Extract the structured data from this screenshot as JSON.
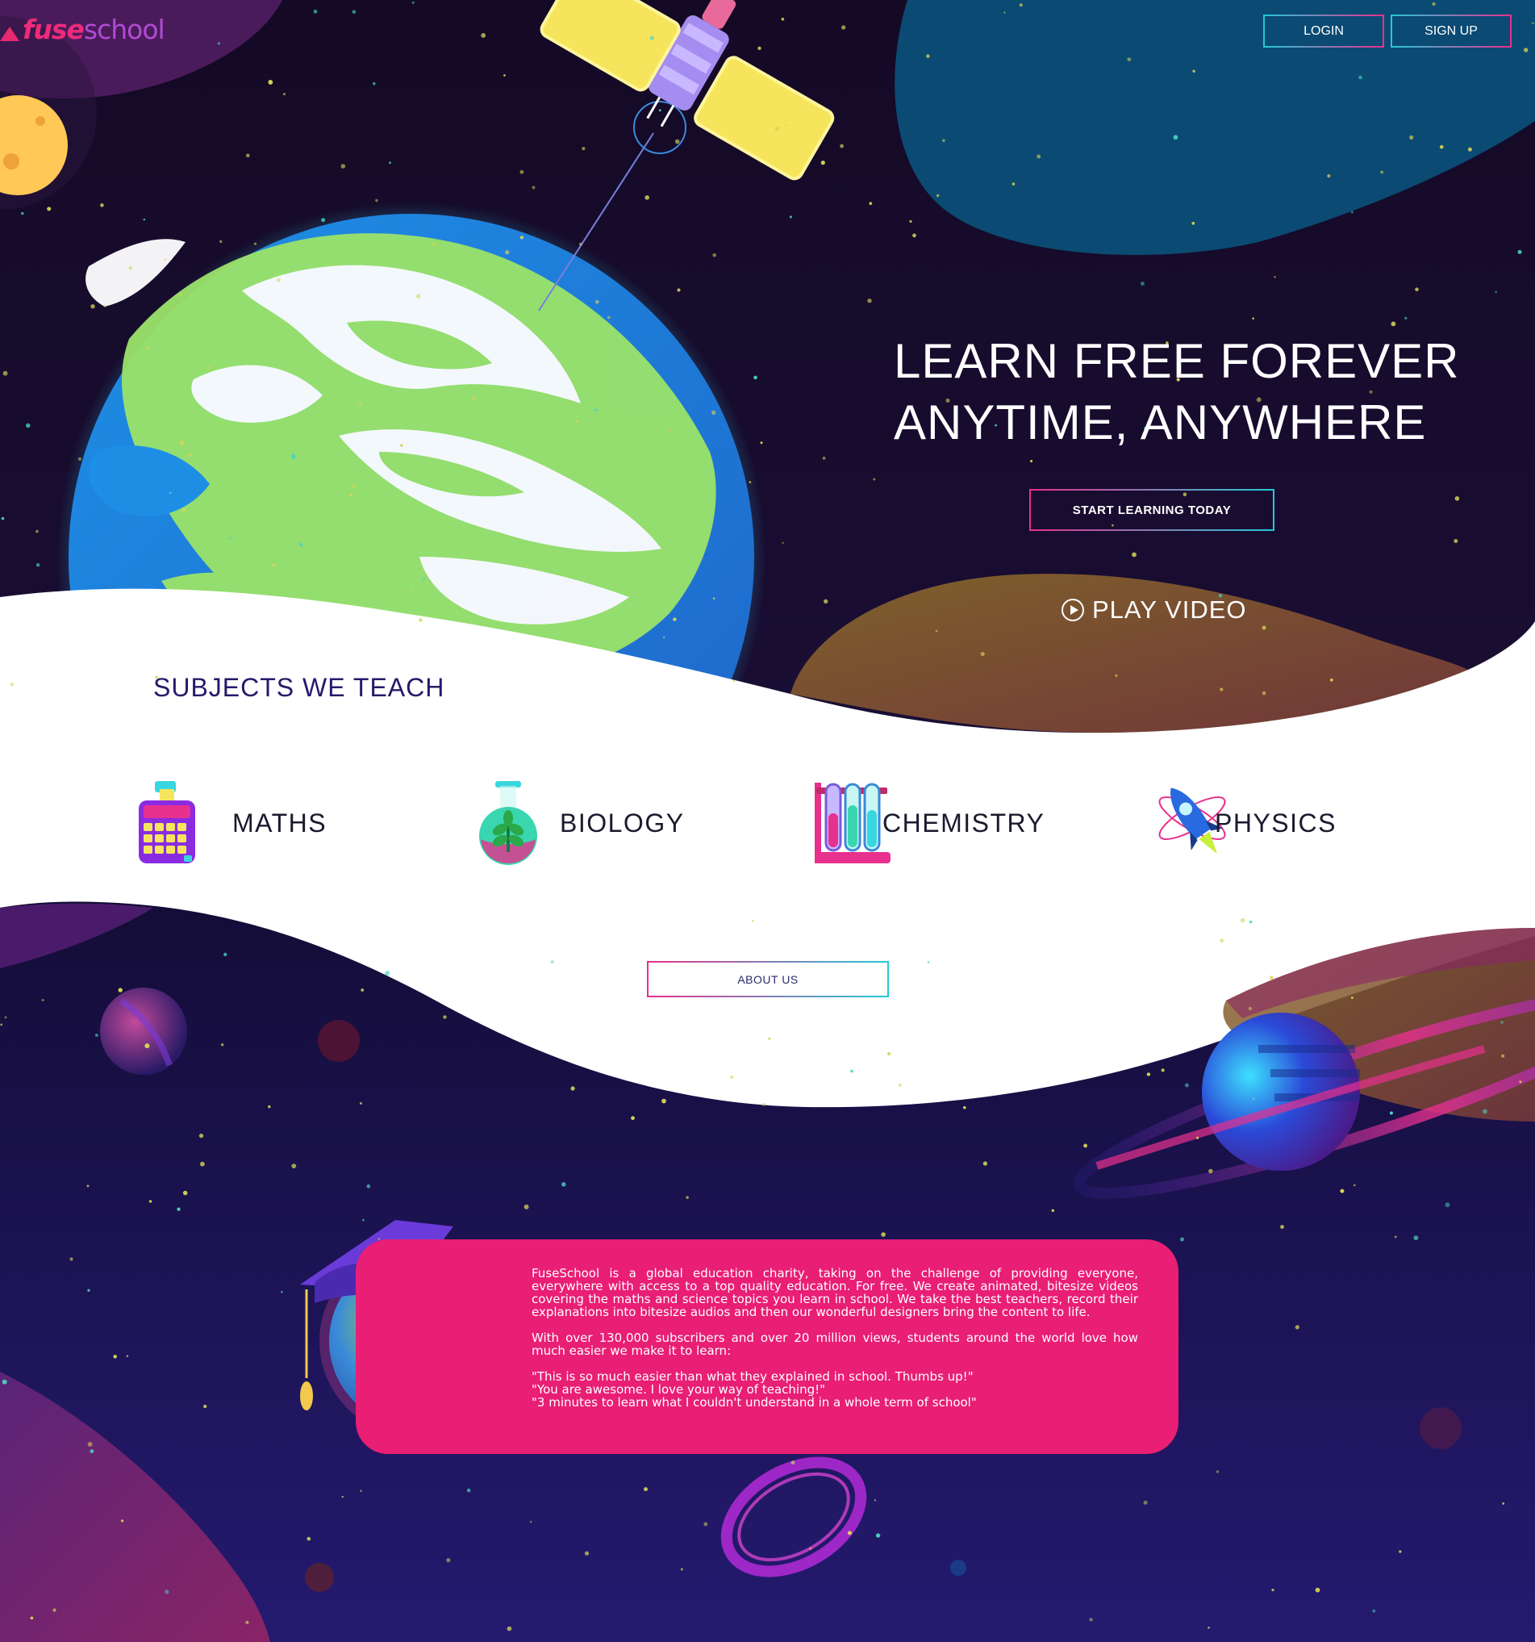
{
  "brand": {
    "name_part1": "fuse",
    "name_part2": "school"
  },
  "header": {
    "login_label": "LOGIN",
    "signup_label": "SIGN UP"
  },
  "hero": {
    "title_line1": "LEARN FREE FOREVER",
    "title_line2": "ANYTIME, ANYWHERE",
    "cta_label": "START LEARNING TODAY",
    "play_label": "PLAY VIDEO"
  },
  "subjects": {
    "heading": "SUBJECTS WE TEACH",
    "items": [
      {
        "label": "MATHS",
        "icon": "calculator-icon"
      },
      {
        "label": "BIOLOGY",
        "icon": "flask-plant-icon"
      },
      {
        "label": "CHEMISTRY",
        "icon": "test-tubes-icon"
      },
      {
        "label": "PHYSICS",
        "icon": "rocket-atom-icon"
      }
    ],
    "about_button_label": "ABOUT US"
  },
  "about": {
    "paragraph1": "FuseSchool is a global education charity, taking on the challenge of providing everyone, everywhere with access to a top quality education. For free. We create animated, bitesize videos covering the maths and science topics you learn in school. We take the best teachers, record their explanations into bitesize audios and then our wonderful designers bring the content to life.",
    "paragraph2": "With over 130,000 subscribers and over 20 million views, students around the world love how much easier we make it to learn:",
    "quotes": [
      "\"This is so much easier than what they explained in school. Thumbs up!\"",
      "\"You are awesome. I love your way of teaching!\"",
      "\"3 minutes to learn what I couldn't understand in a whole term of school\""
    ]
  },
  "colors": {
    "space_dark": "#150d2e",
    "accent_pink": "#e91e75",
    "accent_cyan": "#23c9d8",
    "heading_navy": "#241a6b",
    "blob_blue": "#0b4a73",
    "earth_green": "#9be36a",
    "earth_blue": "#1e8fe6"
  }
}
